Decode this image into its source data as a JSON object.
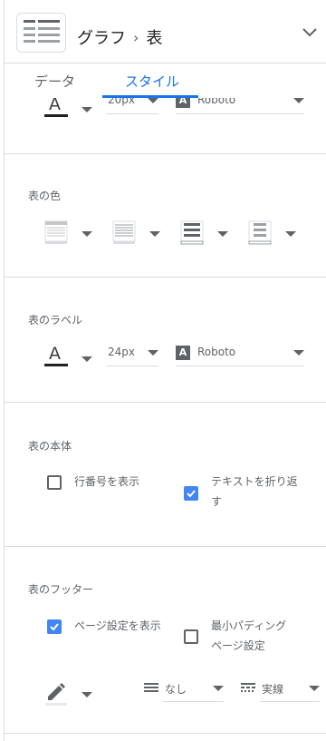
{
  "header": {
    "breadcrumb_parent": "グラフ",
    "separator": "›",
    "breadcrumb_current": "表"
  },
  "tabs": [
    {
      "label": "データ",
      "active": false
    },
    {
      "label": "スタイル",
      "active": true
    }
  ],
  "top_row": {
    "font_size": "20px",
    "font_family": "Roboto"
  },
  "table_colors": {
    "title": "表の色"
  },
  "table_labels": {
    "title": "表のラベル",
    "font_size": "24px",
    "font_family": "Roboto"
  },
  "table_body": {
    "title": "表の本体",
    "show_row_numbers": {
      "label": "行番号を表示",
      "checked": false
    },
    "wrap_text": {
      "label": "テキストを折り返す",
      "checked": true
    }
  },
  "table_footer": {
    "title": "表のフッター",
    "show_pagination": {
      "label": "ページ設定を表示",
      "checked": true
    },
    "min_padding": {
      "label": "最小パディング ページ設定",
      "checked": false
    },
    "border_weight": "なし",
    "border_style": "実線"
  },
  "colors": {
    "accent": "#1a73e8",
    "checkbox": "#4285f4",
    "text": "#5f6368",
    "divider": "#dadce0"
  },
  "icons": {
    "chart": "table-chart-icon",
    "collapse": "chevron-down-icon",
    "font_color": "text-color-icon",
    "font_family": "font-family-icon",
    "header_color": "header-color-icon",
    "row_color": "row-color-icon",
    "odd_row_color": "odd-row-color-icon",
    "border_color": "border-color-icon",
    "pencil": "pencil-icon",
    "border_weight": "line-weight-icon",
    "border_style": "line-style-icon"
  }
}
